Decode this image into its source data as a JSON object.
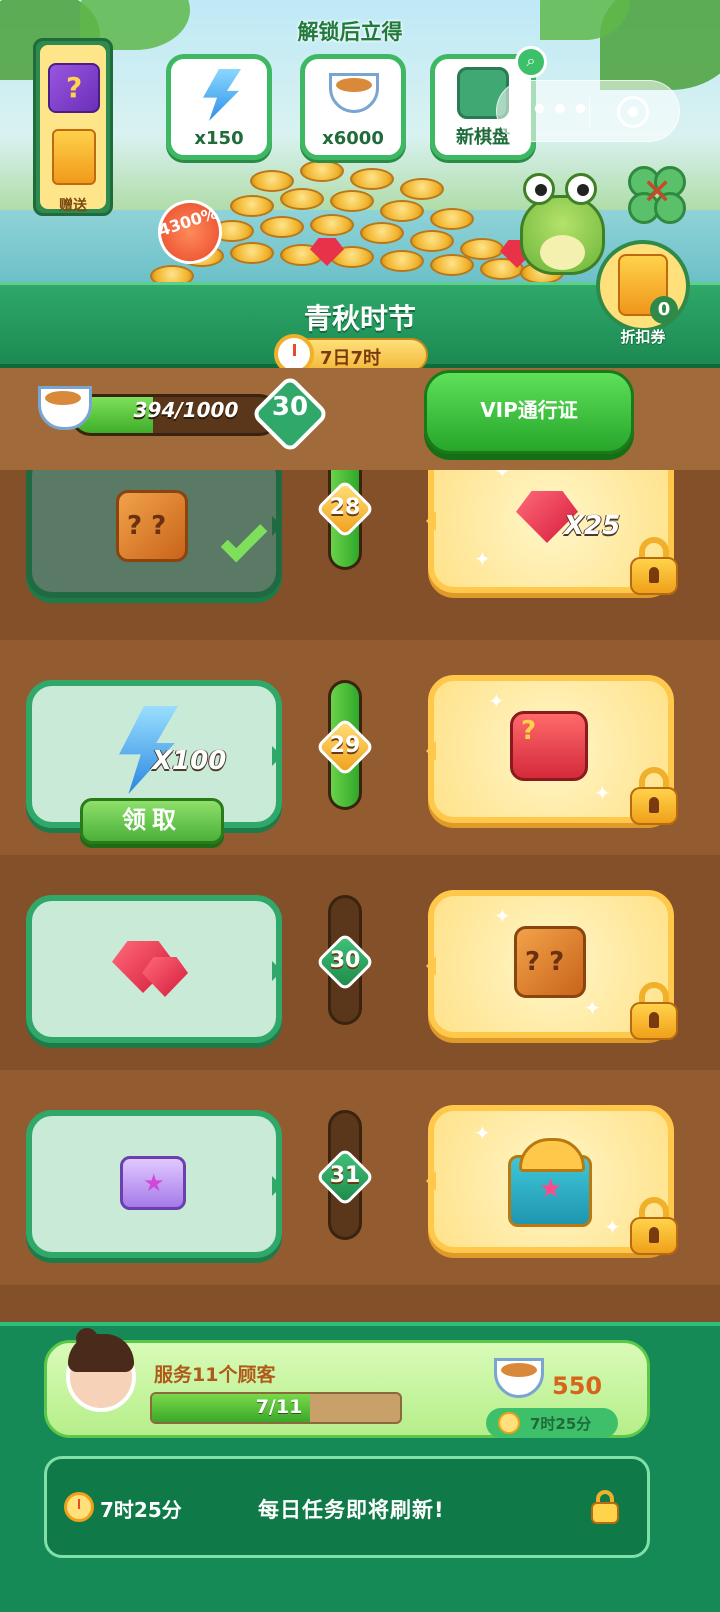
{
  "banner": {
    "unlock_title": "解锁后立得",
    "gift_label": "赠送",
    "discount_badge": "4300%",
    "unlock_rewards": [
      {
        "icon": "energy-bolt-icon",
        "label": "x150"
      },
      {
        "icon": "tea-cup-icon",
        "label": "x6000"
      },
      {
        "icon": "game-board-icon",
        "label": "新棋盘"
      }
    ],
    "capsule_more": "•••",
    "coupon": {
      "count": "0",
      "label": "折扣券"
    }
  },
  "season": {
    "title": "青秋时节",
    "timer": "7日7时"
  },
  "progress": {
    "text": "394/1000",
    "current": 394,
    "max": 1000,
    "level": "30",
    "vip_button": "VIP通行证"
  },
  "rows": [
    {
      "level": "28",
      "free": {
        "icon": "mystery-cube-icon",
        "claimed": true
      },
      "vip": {
        "icon": "ruby-gem-icon",
        "qty": "X25",
        "locked": true
      },
      "track_fill": 1.0
    },
    {
      "level": "29",
      "free": {
        "icon": "energy-bolt-icon",
        "qty": "X100",
        "claim_label": "领取"
      },
      "vip": {
        "icon": "red-mystery-chest-icon",
        "locked": true
      },
      "track_fill": 1.0
    },
    {
      "level": "30",
      "free": {
        "icon": "ruby-pile-icon"
      },
      "vip": {
        "icon": "mystery-cube-icon",
        "locked": true
      },
      "track_fill": 0.0
    },
    {
      "level": "31",
      "free": {
        "icon": "purple-star-chest-icon"
      },
      "vip": {
        "icon": "treasure-chest-icon",
        "locked": true
      },
      "track_fill": 0.0
    }
  ],
  "task": {
    "title": "服务11个顾客",
    "progress_text": "7/11",
    "current": 7,
    "max": 11,
    "reward": "550",
    "timer": "7时25分"
  },
  "daily": {
    "timer": "7时25分",
    "message": "每日任务即将刷新!"
  },
  "colors": {
    "primary_green": "#2fa86a",
    "vip_gold": "#ffc84a",
    "wood_brown": "#84502a"
  }
}
